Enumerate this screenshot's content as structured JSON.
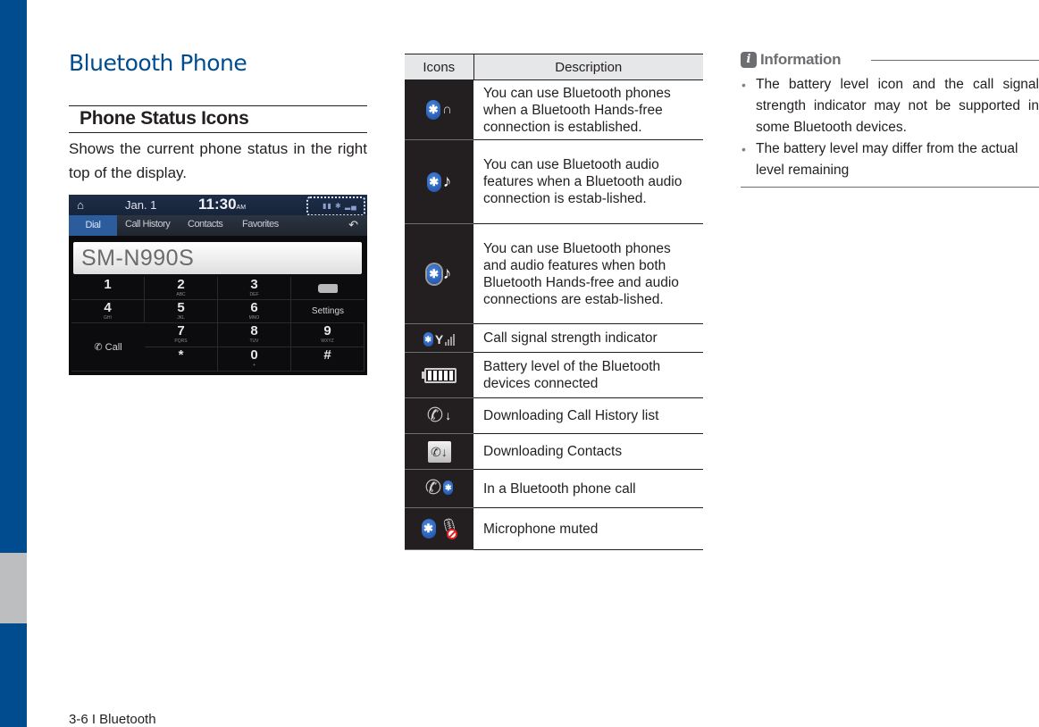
{
  "colors": {
    "brand_blue": "#004c8f",
    "tab_gray": "#bcbec0",
    "table_header_bg": "#e6e7e8",
    "icon_cell_bg": "#231f20",
    "info_gray": "#6d6e71"
  },
  "page": {
    "title": "Bluetooth Phone",
    "section_title": "Phone Status Icons",
    "section_body": "Shows the current phone status in the right top of the display.",
    "footer": "3-6 I Bluetooth"
  },
  "screen": {
    "home_icon": "home-icon",
    "date": "Jan. 1",
    "time": "11:30",
    "time_suffix": "AM",
    "status_icons": "battery-icon bluetooth-icon signal-icon",
    "tabs": [
      "Dial",
      "Call History",
      "Contacts",
      "Favorites"
    ],
    "back_icon": "back-icon",
    "number_value": "SM-N990S",
    "keys": [
      {
        "digit": "1",
        "letters": ""
      },
      {
        "digit": "2",
        "letters": "ABC"
      },
      {
        "digit": "3",
        "letters": "DEF"
      },
      {
        "digit": "4",
        "letters": "GHI"
      },
      {
        "digit": "5",
        "letters": "JKL"
      },
      {
        "digit": "6",
        "letters": "MNO"
      },
      {
        "digit": "7",
        "letters": "PQRS"
      },
      {
        "digit": "8",
        "letters": "TUV"
      },
      {
        "digit": "9",
        "letters": "WXYZ"
      },
      {
        "digit": "*",
        "letters": ""
      },
      {
        "digit": "0",
        "letters": "+"
      },
      {
        "digit": "#",
        "letters": ""
      }
    ],
    "settings_label": "Settings",
    "call_label": "Call"
  },
  "table": {
    "headers": {
      "icons": "Icons",
      "description": "Description"
    },
    "rows": [
      {
        "icon": "bluetooth-handsfree-icon",
        "description": "You can use Bluetooth phones when a Bluetooth Hands-free connection is established."
      },
      {
        "icon": "bluetooth-audio-icon",
        "description": "You can use Bluetooth audio features when a Bluetooth audio connection is estab-lished."
      },
      {
        "icon": "bluetooth-handsfree-audio-icon",
        "description": "You can use Bluetooth phones and audio features when both Bluetooth Hands-free and audio connections are estab-lished."
      },
      {
        "icon": "call-signal-strength-icon",
        "description": "Call signal strength indicator"
      },
      {
        "icon": "battery-level-icon",
        "description": "Battery level of the Bluetooth devices connected"
      },
      {
        "icon": "downloading-call-history-icon",
        "description": "Downloading Call History list"
      },
      {
        "icon": "downloading-contacts-icon",
        "description": "Downloading Contacts"
      },
      {
        "icon": "bluetooth-phone-call-icon",
        "description": "In a Bluetooth phone call"
      },
      {
        "icon": "microphone-muted-icon",
        "description": "Microphone muted"
      }
    ]
  },
  "info": {
    "badge": "i",
    "title": "Information",
    "items": [
      "The battery level icon and the call signal strength indicator may not be supported in some Bluetooth devices.",
      "The battery level may differ from the actual level remaining"
    ]
  }
}
